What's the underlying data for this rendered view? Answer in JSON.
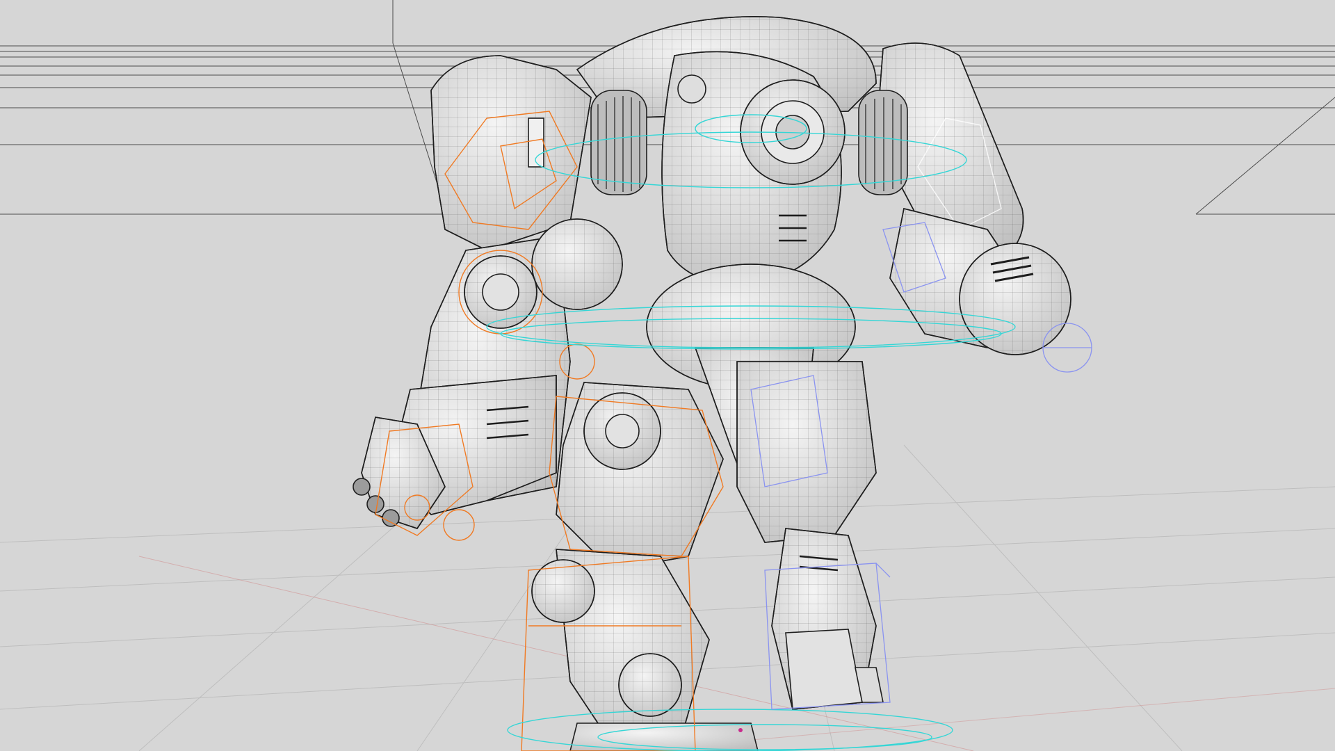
{
  "viewport": {
    "label": "",
    "background_color": "#d6d6d6",
    "wire_color": "#1e1e1e",
    "surface_color": "#ececec",
    "rig_left_color": "#f07a23",
    "rig_center_color": "#35d6d6",
    "rig_right_color": "#8a93f0",
    "grid_color": "#bcbcbc",
    "axis_color": "#d08a8a"
  },
  "scene": {
    "model": "mech-robot-wireframe",
    "shading": "wireframe-on-shaded",
    "rig_controls_visible": true
  }
}
